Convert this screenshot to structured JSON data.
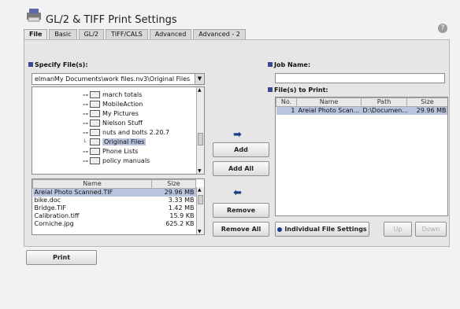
{
  "title": "GL/2 & TIFF Print Settings",
  "tabs": [
    {
      "label": "File",
      "active": true
    },
    {
      "label": "Basic",
      "active": false
    },
    {
      "label": "GL/2",
      "active": false
    },
    {
      "label": "TIFF/CALS",
      "active": false
    },
    {
      "label": "Advanced",
      "active": false
    },
    {
      "label": "Advanced - 2",
      "active": false
    }
  ],
  "specify": {
    "label": "Specify File(s):",
    "path": "elmanMy Documents\\work files.nv3\\Original Files",
    "tree": [
      {
        "label": "march totals",
        "selected": false
      },
      {
        "label": "MobileAction",
        "selected": false
      },
      {
        "label": "My Pictures",
        "selected": false
      },
      {
        "label": "Nielson Stuff",
        "selected": false
      },
      {
        "label": "nuts and bolts 2.20.7",
        "selected": false
      },
      {
        "label": "Original Files",
        "selected": true
      },
      {
        "label": "Phone Lists",
        "selected": false
      },
      {
        "label": "policy manuals",
        "selected": false
      }
    ],
    "columns": {
      "name": "Name",
      "size": "Size"
    },
    "files": [
      {
        "name": "Areial Photo Scanned.TIF",
        "size": "29.96 MB",
        "selected": true
      },
      {
        "name": "bike.doc",
        "size": "3.33 MB",
        "selected": false
      },
      {
        "name": "Bridge.TIF",
        "size": "1.42 MB",
        "selected": false
      },
      {
        "name": "Calibration.tiff",
        "size": "15.9 KB",
        "selected": false
      },
      {
        "name": "Corniche.jpg",
        "size": "625.2 KB",
        "selected": false
      }
    ]
  },
  "actions": {
    "add": "Add",
    "add_all": "Add All",
    "remove": "Remove",
    "remove_all": "Remove All"
  },
  "job": {
    "label": "Job Name:",
    "value": ""
  },
  "print_list": {
    "label": "File(s) to Print:",
    "columns": {
      "no": "No.",
      "name": "Name",
      "path": "Path",
      "size": "Size"
    },
    "rows": [
      {
        "no": "1",
        "name": "Areial Photo Scan...",
        "path": "D:\\Documen...",
        "size": "29.96 MB"
      }
    ]
  },
  "bottom_buttons": {
    "individual": "Individual File Settings",
    "up": "Up",
    "down": "Down",
    "print": "Print"
  },
  "colors": {
    "accent": "#3b4a8f",
    "selection": "#b9c4dd"
  }
}
